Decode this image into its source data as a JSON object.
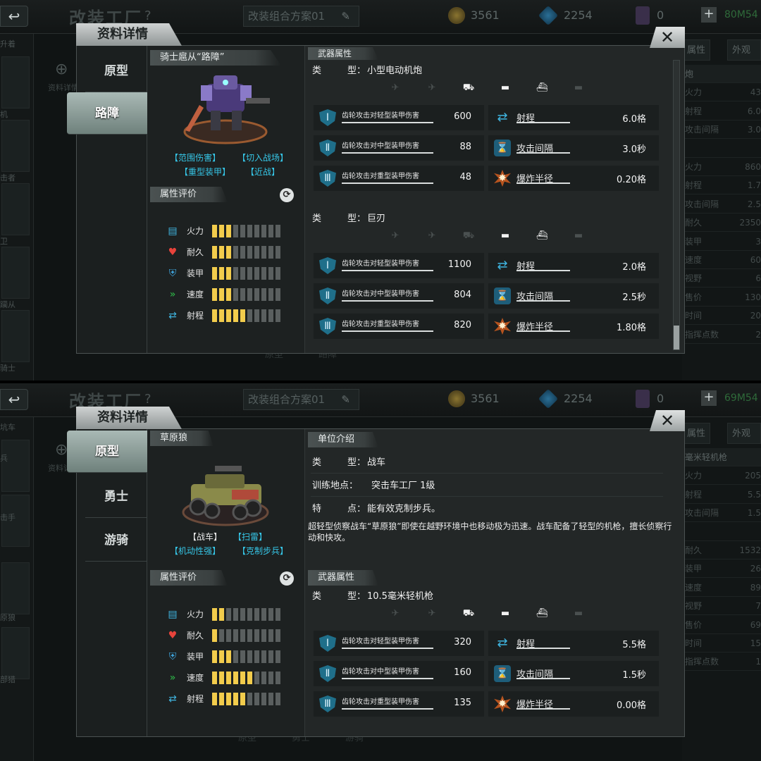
{
  "screen1": {
    "background": {
      "title": "改装工厂",
      "help": "?",
      "scheme": "改装组合方案01",
      "gold": "3561",
      "gems": "2254",
      "cards": "0",
      "plus": "+",
      "status": "80M54",
      "left_filter": "升着",
      "left_labels": [
        "机",
        "击者",
        "卫",
        "躏从",
        "骑士"
      ],
      "zoom_label": "资料详情",
      "right_tabs": [
        "属性",
        "外观度"
      ],
      "right_rows": [
        {
          "k": "炮",
          "v": ""
        },
        {
          "k": "火力",
          "v": "43"
        },
        {
          "k": "射程",
          "v": "6.0"
        },
        {
          "k": "攻击间隔",
          "v": "3.0"
        },
        {
          "k": "",
          "v": ""
        },
        {
          "k": "火力",
          "v": "860"
        },
        {
          "k": "射程",
          "v": "1.7"
        },
        {
          "k": "攻击间隔",
          "v": "2.5"
        },
        {
          "k": "耐久",
          "v": "2350"
        },
        {
          "k": "装甲",
          "v": "3"
        },
        {
          "k": "速度",
          "v": "60"
        },
        {
          "k": "视野",
          "v": "6"
        },
        {
          "k": "售价",
          "v": "130"
        },
        {
          "k": "时间",
          "v": "20"
        },
        {
          "k": "指挥点数",
          "v": "2"
        }
      ],
      "bottom_ghost": [
        "原型",
        "路障"
      ]
    },
    "dialog": {
      "title": "资料详情",
      "close": "✕",
      "tabs": [
        "原型",
        "路障"
      ],
      "unit_name": "骑士扈从“路障”",
      "tags": [
        "【范围伤害】",
        "【切入战场】",
        "【重型装甲】",
        "【近战】"
      ],
      "attr_header": "属性评价",
      "attributes": [
        {
          "name": "火力",
          "icon": "firepower-icon",
          "level": 3
        },
        {
          "name": "耐久",
          "icon": "heart-icon",
          "level": 3
        },
        {
          "name": "装甲",
          "icon": "armor-icon",
          "level": 3
        },
        {
          "name": "速度",
          "icon": "speed-icon",
          "level": 3
        },
        {
          "name": "射程",
          "icon": "range-icon",
          "level": 5
        }
      ],
      "weapons_header": "武器属性",
      "weapons": [
        {
          "type_key": "类",
          "type_key2": "型：",
          "type": "小型电动机炮",
          "targets": [
            false,
            false,
            true,
            true,
            true,
            false
          ],
          "rows": [
            {
              "label": "齿轮攻击对轻型装甲伤害",
              "value": "600",
              "stat": "射程",
              "stat_value": "6.0格"
            },
            {
              "label": "齿轮攻击对中型装甲伤害",
              "value": "88",
              "stat": "攻击间隔",
              "stat_value": "3.0秒"
            },
            {
              "label": "齿轮攻击对重型装甲伤害",
              "value": "48",
              "stat": "爆炸半径",
              "stat_value": "0.20格"
            }
          ]
        },
        {
          "type_key": "类",
          "type_key2": "型：",
          "type": "巨刃",
          "targets": [
            false,
            false,
            false,
            true,
            true,
            false
          ],
          "rows": [
            {
              "label": "齿轮攻击对轻型装甲伤害",
              "value": "1100",
              "stat": "射程",
              "stat_value": "2.0格"
            },
            {
              "label": "齿轮攻击对中型装甲伤害",
              "value": "804",
              "stat": "攻击间隔",
              "stat_value": "2.5秒"
            },
            {
              "label": "齿轮攻击对重型装甲伤害",
              "value": "820",
              "stat": "爆炸半径",
              "stat_value": "1.80格"
            }
          ]
        }
      ]
    }
  },
  "screen2": {
    "background": {
      "title": "改装工厂",
      "help": "?",
      "scheme": "改装组合方案01",
      "gold": "3561",
      "gems": "2254",
      "cards": "0",
      "plus": "+",
      "status": "69M54",
      "left_filter": "坑车",
      "left_labels": [
        "兵",
        "击手",
        "原狼",
        "部猎"
      ],
      "zoom_label": "资料详",
      "right_tabs": [
        "属性",
        "外观度"
      ],
      "right_rows": [
        {
          "k": "毫米轻机枪",
          "v": ""
        },
        {
          "k": "火力",
          "v": "205"
        },
        {
          "k": "射程",
          "v": "5.5"
        },
        {
          "k": "攻击间隔",
          "v": "1.5"
        },
        {
          "k": "",
          "v": ""
        },
        {
          "k": "耐久",
          "v": "1532"
        },
        {
          "k": "装甲",
          "v": "26"
        },
        {
          "k": "速度",
          "v": "89"
        },
        {
          "k": "视野",
          "v": "7"
        },
        {
          "k": "售价",
          "v": "69"
        },
        {
          "k": "时间",
          "v": "15"
        },
        {
          "k": "指挥点数",
          "v": "1"
        }
      ],
      "bottom_ghost": [
        "原型",
        "勇士",
        "游骑"
      ]
    },
    "dialog": {
      "title": "资料详情",
      "close": "✕",
      "tabs": [
        "原型",
        "勇士",
        "游骑"
      ],
      "unit_name": "草原狼",
      "tags": [
        "【战车】",
        "【扫雷】",
        "【机动性强】",
        "【克制步兵】"
      ],
      "attr_header": "属性评价",
      "attributes": [
        {
          "name": "火力",
          "icon": "firepower-icon",
          "level": 2
        },
        {
          "name": "耐久",
          "icon": "heart-icon",
          "level": 1
        },
        {
          "name": "装甲",
          "icon": "armor-icon",
          "level": 3
        },
        {
          "name": "速度",
          "icon": "speed-icon",
          "level": 6
        },
        {
          "name": "射程",
          "icon": "range-icon",
          "level": 5
        }
      ],
      "intro_header": "单位介绍",
      "intro": [
        {
          "k": "类",
          "k2": "型：",
          "v": "战车"
        },
        {
          "k": "训练地点：",
          "k2": "",
          "v": "突击车工厂 1级"
        },
        {
          "k": "特",
          "k2": "点：",
          "v": "能有效克制步兵。"
        }
      ],
      "description": "超轻型侦察战车“草原狼”即使在越野环境中也移动极为迅速。战车配备了轻型的机枪，擅长侦察行动和快攻。",
      "weapons_header": "武器属性",
      "weapons": [
        {
          "type_key": "类",
          "type_key2": "型：",
          "type": "10.5毫米轻机枪",
          "targets": [
            false,
            false,
            true,
            true,
            true,
            false
          ],
          "rows": [
            {
              "label": "齿轮攻击对轻型装甲伤害",
              "value": "320",
              "stat": "射程",
              "stat_value": "5.5格"
            },
            {
              "label": "齿轮攻击对中型装甲伤害",
              "value": "160",
              "stat": "攻击间隔",
              "stat_value": "1.5秒"
            },
            {
              "label": "齿轮攻击对重型装甲伤害",
              "value": "135",
              "stat": "爆炸半径",
              "stat_value": "0.00格"
            }
          ]
        }
      ]
    }
  },
  "target_icons": [
    "✈",
    "✈",
    "⛟",
    "▬",
    "⛴",
    "▬"
  ],
  "stat_icons": [
    "ic-arrow",
    "ic-hour",
    "ic-blast"
  ],
  "colors": {
    "tag": "#36c7e8",
    "bar_on": "#f2cc4c",
    "bar_off": "#5a5f5f"
  }
}
